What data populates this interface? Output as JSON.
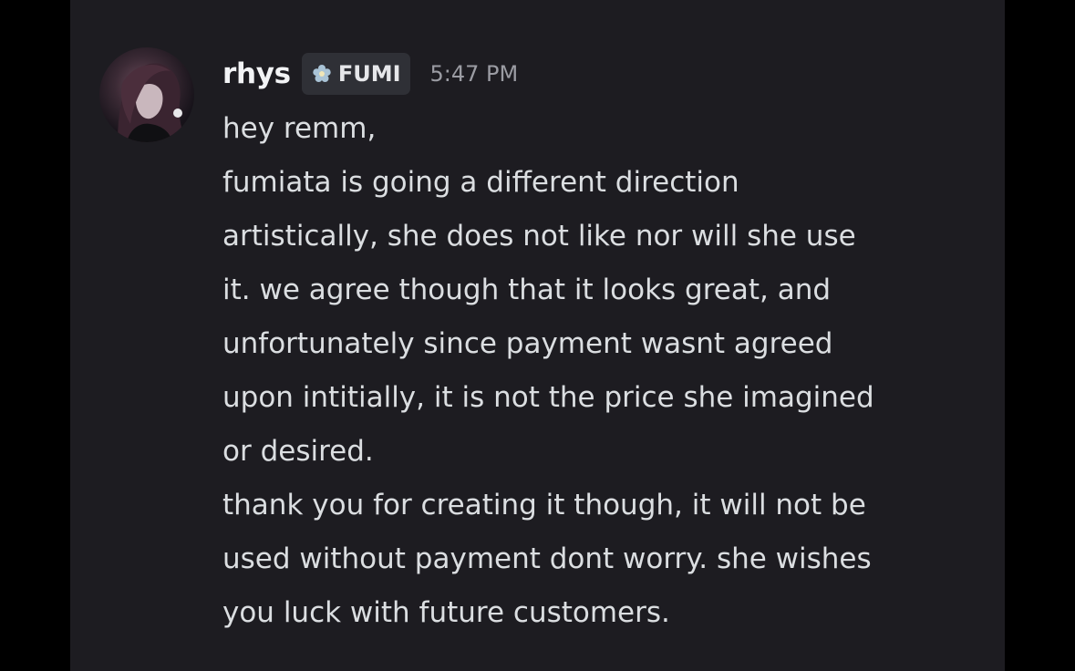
{
  "message": {
    "username": "rhys",
    "tag_label": "FUMI",
    "timestamp": "5:47 PM",
    "icons": {
      "avatar": "user-avatar",
      "tag_icon": "flower-icon"
    },
    "lines": [
      "hey remm,",
      "fumiata is going a different direction",
      "artistically, she does not like nor will she use",
      "it. we agree though that it looks great, and",
      "unfortunately since payment wasnt agreed",
      "upon intitially, it is not the price she imagined",
      "or desired.",
      "thank you for creating it though, it will not be",
      "used without payment dont worry. she wishes",
      "you luck with future customers."
    ]
  },
  "colors": {
    "background": "#1d1c21",
    "username": "#f2f3f5",
    "message_text": "#dbdee1",
    "timestamp": "#9b9ca3",
    "tag_background": "#2f3036"
  }
}
